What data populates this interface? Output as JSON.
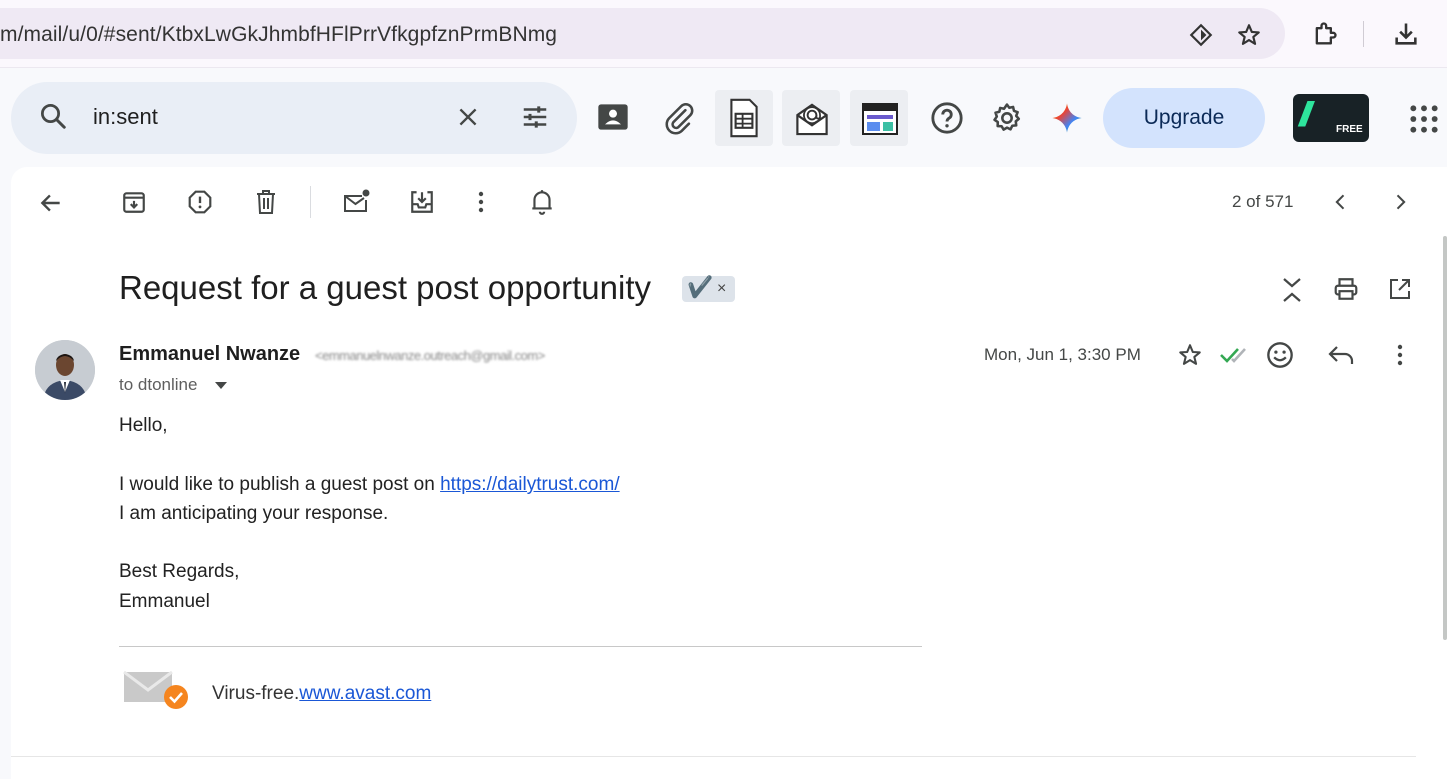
{
  "browser": {
    "url": "m/mail/u/0/#sent/KtbxLwGkJhmbfHFlPrrVfkgpfznPrmBNmg",
    "icons": [
      "extension-diamond-icon",
      "bookmark-star-icon",
      "extensions-puzzle-icon",
      "download-icon"
    ]
  },
  "search": {
    "query": "in:sent",
    "icons": [
      "search-icon",
      "clear-search-icon",
      "search-options-icon"
    ]
  },
  "header": {
    "upgrade_label": "Upgrade",
    "free_badge": "FREE",
    "icons": [
      "contacts-icon",
      "attachment-icon",
      "sheets-icon",
      "email-tracker-icon",
      "dashboard-icon",
      "help-icon",
      "settings-icon",
      "gemini-icon",
      "apps-grid-icon"
    ]
  },
  "toolbar": {
    "pager": "2 of 571",
    "icons": [
      "back-arrow-icon",
      "archive-icon",
      "report-spam-icon",
      "delete-icon",
      "mark-unread-icon",
      "move-to-icon",
      "more-vert-icon",
      "snooze-bell-icon",
      "prev-chevron-icon",
      "next-chevron-icon"
    ]
  },
  "message": {
    "subject": "Request for a guest post opportunity",
    "label_check": "✔️",
    "label_close": "×",
    "sender_name": "Emmanuel Nwanze",
    "sender_email": "<emmanuelnwanze.outreach@gmail.com>",
    "to": "to dtonline",
    "date": "Mon, Jun 1, 3:30 PM",
    "body": {
      "greeting": "Hello,",
      "line1_prefix": "I would like to publish a guest post on ",
      "line1_link": "https://dailytrust.com/",
      "line2": "I am anticipating your response.",
      "closing": "Best Regards,",
      "signature": "Emmanuel"
    },
    "virus_free_prefix": "Virus-free.",
    "virus_free_link": "www.avast.com"
  },
  "colors": {
    "accent_blue": "#d3e3fd",
    "link_blue": "#1a57d6",
    "read_check_green": "#34a853",
    "avast_orange": "#f5851f"
  }
}
